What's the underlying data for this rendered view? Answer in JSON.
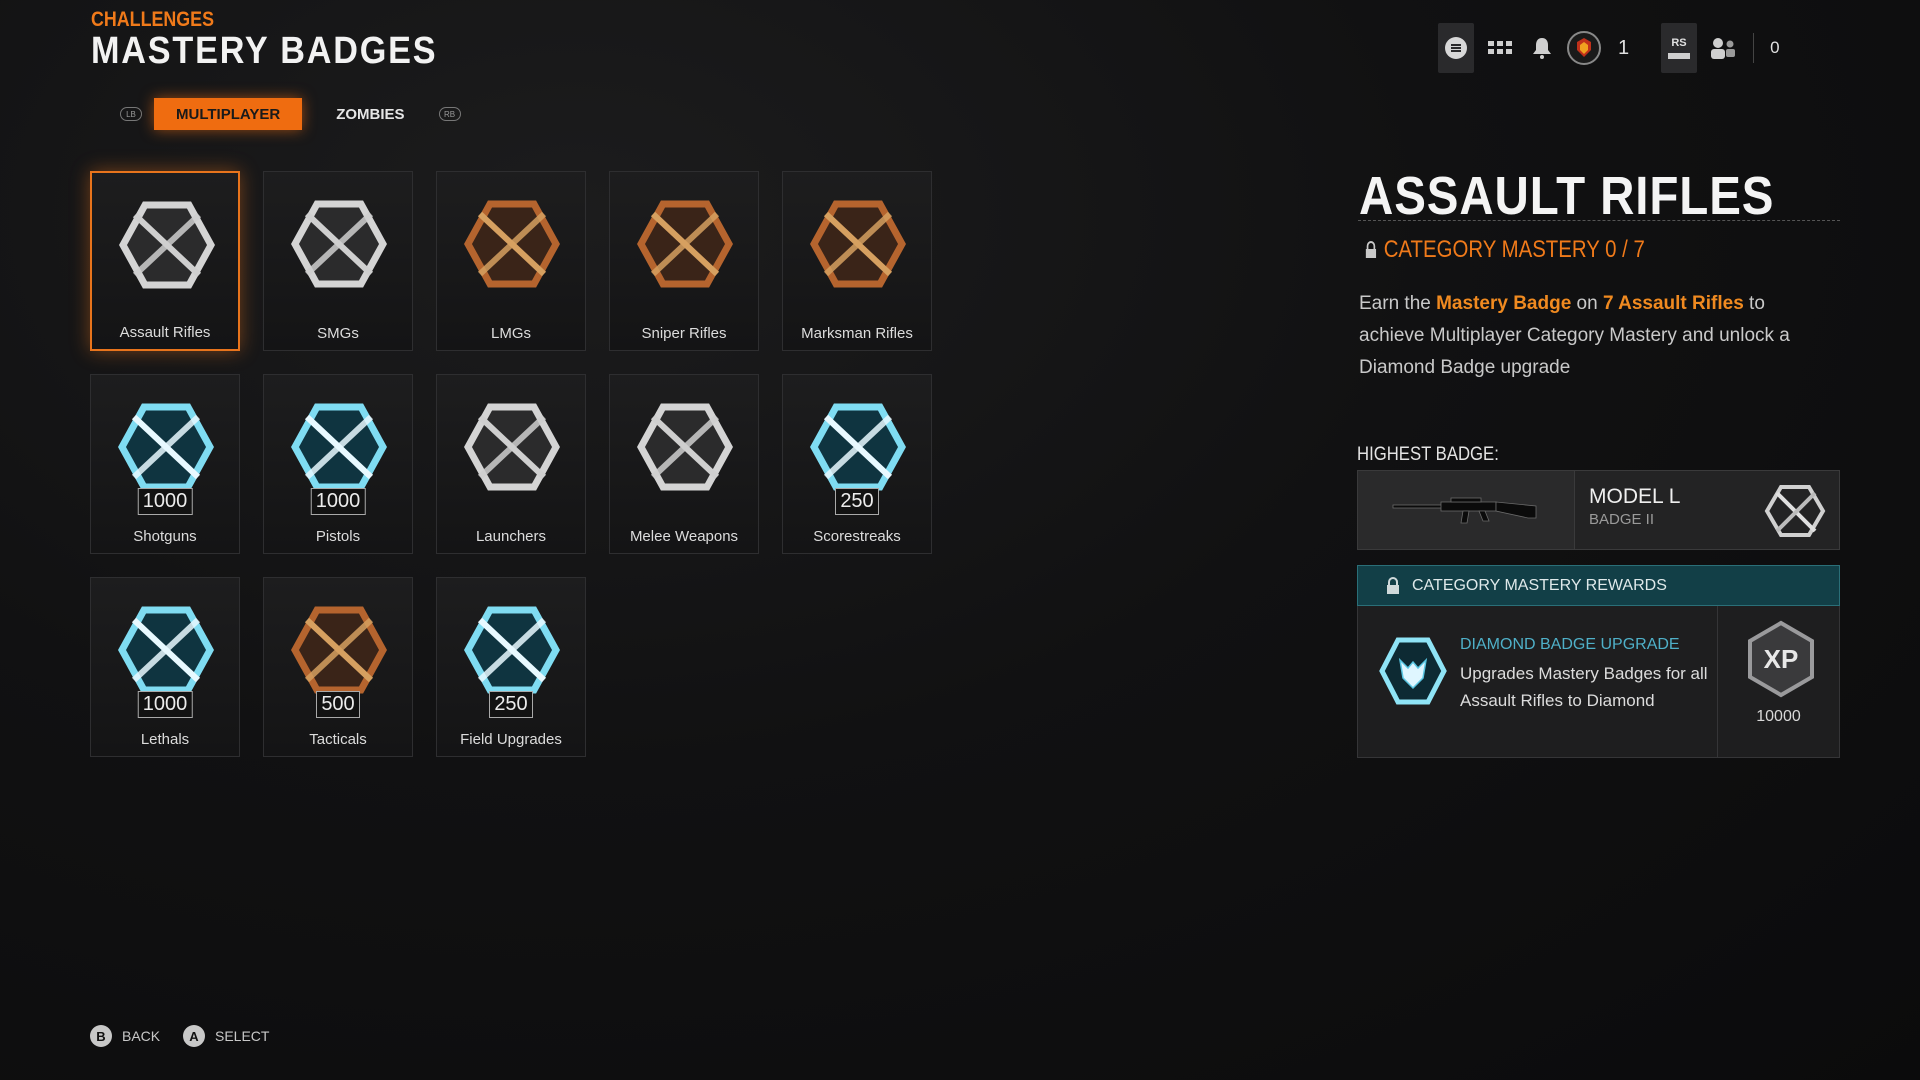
{
  "header": {
    "breadcrumb": "CHALLENGES",
    "title": "MASTERY BADGES"
  },
  "tabs": {
    "left_bumper": "LB",
    "right_bumper": "RB",
    "items": [
      {
        "label": "MULTIPLAYER",
        "active": true
      },
      {
        "label": "ZOMBIES",
        "active": false
      }
    ]
  },
  "topbar": {
    "rank_value": "1",
    "rs_label": "RS",
    "party_count": "0"
  },
  "categories": [
    {
      "label": "Assault Rifles",
      "badge": "silver",
      "selected": true
    },
    {
      "label": "SMGs",
      "badge": "silver"
    },
    {
      "label": "LMGs",
      "badge": "bronze"
    },
    {
      "label": "Sniper Rifles",
      "badge": "bronze"
    },
    {
      "label": "Marksman Rifles",
      "badge": "bronze"
    },
    {
      "label": "Shotguns",
      "badge": "diamond",
      "count": "1000"
    },
    {
      "label": "Pistols",
      "badge": "diamond",
      "count": "1000"
    },
    {
      "label": "Launchers",
      "badge": "silver"
    },
    {
      "label": "Melee Weapons",
      "badge": "silver"
    },
    {
      "label": "Scorestreaks",
      "badge": "diamond",
      "count": "250"
    },
    {
      "label": "Lethals",
      "badge": "diamond",
      "count": "1000"
    },
    {
      "label": "Tacticals",
      "badge": "bronze",
      "count": "500"
    },
    {
      "label": "Field Upgrades",
      "badge": "diamond",
      "count": "250"
    }
  ],
  "detail": {
    "title": "ASSAULT RIFLES",
    "mastery": "CATEGORY MASTERY 0 / 7",
    "desc_parts": [
      "Earn the ",
      "Mastery Badge",
      " on ",
      "7 Assault Rifles",
      " to achieve Multiplayer Category Mastery and unlock a Diamond Badge upgrade"
    ],
    "highest_badge_label": "HIGHEST BADGE:",
    "highest_badge_name": "MODEL L",
    "highest_badge_sub": "BADGE II",
    "rewards_header": "CATEGORY MASTERY REWARDS",
    "reward_title": "DIAMOND BADGE UPGRADE",
    "reward_desc": "Upgrades Mastery Badges for all Assault Rifles to Diamond",
    "reward_xp_label": "XP",
    "reward_xp_value": "10000"
  },
  "footer": [
    {
      "key": "B",
      "label": "BACK"
    },
    {
      "key": "A",
      "label": "SELECT"
    }
  ],
  "colors": {
    "accent": "#ef6c10",
    "diamond": "#6fd6ee",
    "bronze": "#b8642f",
    "silver": "#cfcfcf",
    "teal": "#123f47"
  }
}
